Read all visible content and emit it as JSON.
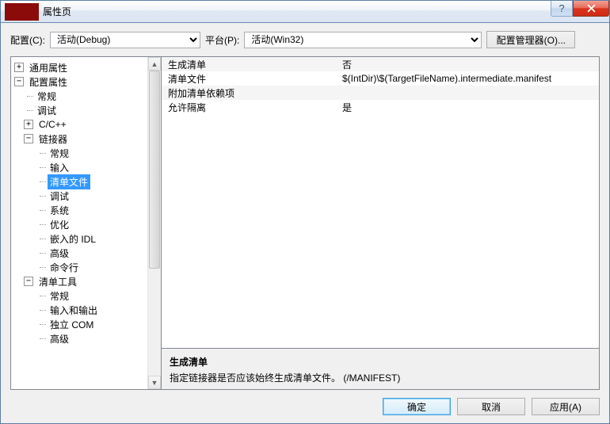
{
  "title": "属性页",
  "titlebar": {
    "help_symbol": "?",
    "close_label": "X"
  },
  "config_row": {
    "config_label": "配置(C):",
    "config_value": "活动(Debug)",
    "platform_label": "平台(P):",
    "platform_value": "活动(Win32)",
    "config_mgr_label": "配置管理器(O)..."
  },
  "tree": {
    "root1": {
      "expander": "+",
      "label": "通用属性"
    },
    "root2": {
      "expander": "−",
      "label": "配置属性"
    },
    "r2_children": {
      "n0": "常规",
      "n1": "调试",
      "n2": "C/C++",
      "linker": {
        "expander": "−",
        "label": "链接器"
      },
      "linker_children": {
        "l0": "常规",
        "l1": "输入",
        "l2": "清单文件",
        "l3": "调试",
        "l4": "系统",
        "l5": "优化",
        "l6": "嵌入的 IDL",
        "l7": "高级",
        "l8": "命令行"
      },
      "manifest": {
        "expander": "−",
        "label": "清单工具"
      },
      "manifest_children": {
        "m0": "常规",
        "m1": "输入和输出",
        "m2": "独立 COM",
        "m3": "高级"
      }
    }
  },
  "properties": [
    {
      "name": "生成清单",
      "value": "否"
    },
    {
      "name": "清单文件",
      "value": "$(IntDir)\\$(TargetFileName).intermediate.manifest"
    },
    {
      "name": "附加清单依赖项",
      "value": ""
    },
    {
      "name": "允许隔离",
      "value": "是"
    }
  ],
  "description": {
    "title": "生成清单",
    "body": "指定链接器是否应该始终生成清单文件。     (/MANIFEST)"
  },
  "buttons": {
    "ok": "确定",
    "cancel": "取消",
    "apply": "应用(A)"
  }
}
